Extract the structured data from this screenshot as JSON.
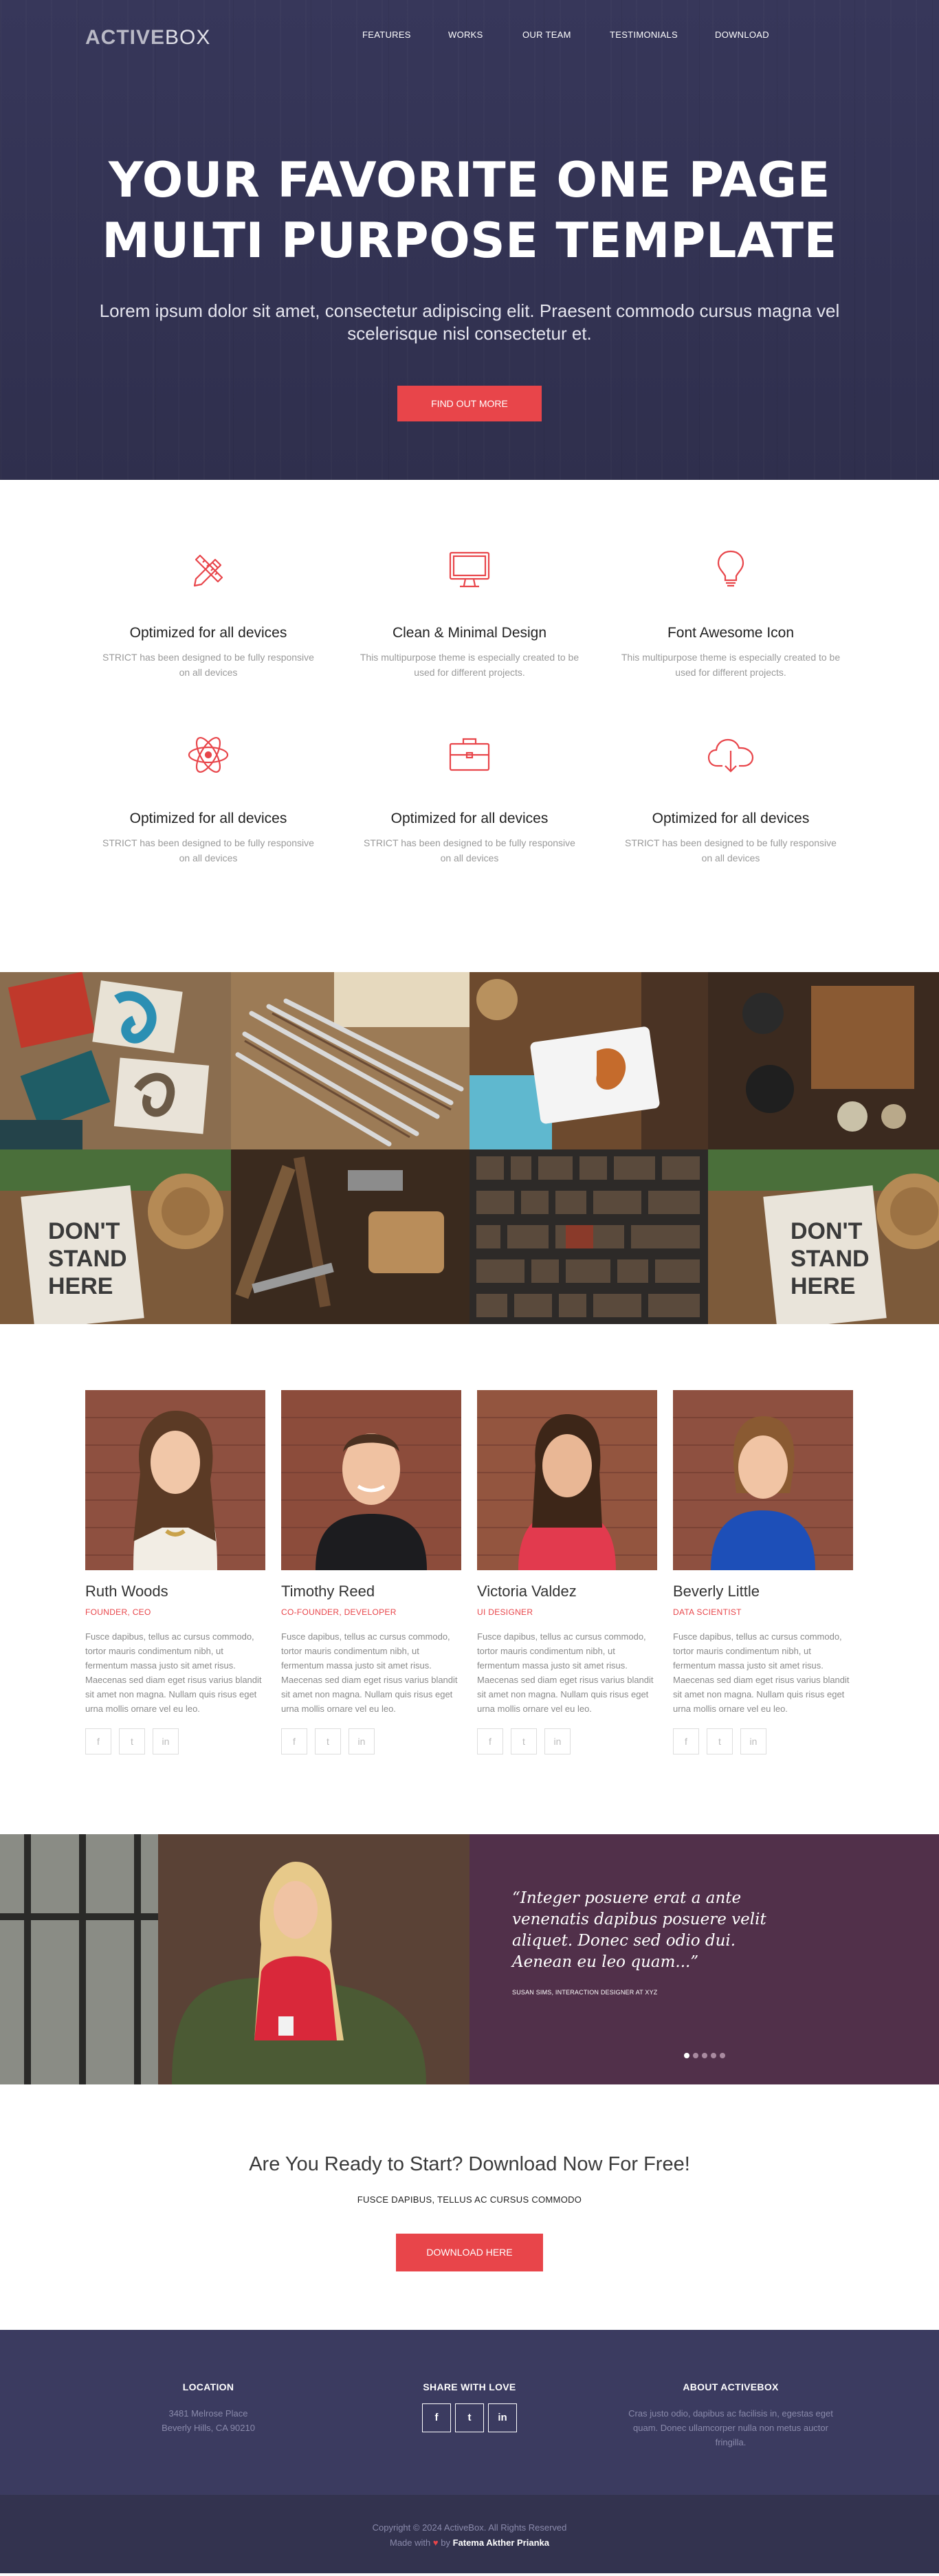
{
  "brand": {
    "logo_bold": "ACTIVE",
    "logo_light": "BOX"
  },
  "nav": [
    "FEATURES",
    "WORKS",
    "OUR TEAM",
    "TESTIMONIALS",
    "DOWNLOAD"
  ],
  "hero": {
    "title_line1": "YOUR FAVORITE ONE PAGE",
    "title_line2": "MULTI PURPOSE TEMPLATE",
    "subtitle": "Lorem ipsum dolor sit amet, consectetur adipiscing elit. Praesent commodo cursus magna vel scelerisque nisl consectetur et.",
    "button": "FIND OUT MORE"
  },
  "colors": {
    "accent": "#e8454a",
    "hero_bg": "#33334f",
    "footer_bg": "#3b3b60",
    "testimonial_bg": "#51304a"
  },
  "features": [
    {
      "icon": "pencil-ruler-icon",
      "title": "Optimized for all devices",
      "text": "STRICT has been designed to be fully responsive on all devices"
    },
    {
      "icon": "monitor-icon",
      "title": "Clean & Minimal Design",
      "text": "This multipurpose theme is especially created to be used for different projects."
    },
    {
      "icon": "lightbulb-icon",
      "title": "Font Awesome Icon",
      "text": "This multipurpose theme is especially created to be used for different projects."
    },
    {
      "icon": "atom-icon",
      "title": "Optimized for all devices",
      "text": "STRICT has been designed to be fully responsive on all devices"
    },
    {
      "icon": "briefcase-icon",
      "title": "Optimized for all devices",
      "text": "STRICT has been designed to be fully responsive on all devices"
    },
    {
      "icon": "cloud-download-icon",
      "title": "Optimized for all devices",
      "text": "STRICT has been designed to be fully responsive on all devices"
    }
  ],
  "team": [
    {
      "name": "Ruth Woods",
      "role": "FOUNDER, CEO",
      "bio": "Fusce dapibus, tellus ac cursus commodo, tortor mauris condimentum nibh, ut fermentum massa justo sit amet risus. Maecenas sed diam eget risus varius blandit sit amet non magna. Nullam quis risus eget urna mollis ornare vel eu leo."
    },
    {
      "name": "Timothy Reed",
      "role": "CO-FOUNDER, DEVELOPER",
      "bio": "Fusce dapibus, tellus ac cursus commodo, tortor mauris condimentum nibh, ut fermentum massa justo sit amet risus. Maecenas sed diam eget risus varius blandit sit amet non magna. Nullam quis risus eget urna mollis ornare vel eu leo."
    },
    {
      "name": "Victoria Valdez",
      "role": "UI DESIGNER",
      "bio": "Fusce dapibus, tellus ac cursus commodo, tortor mauris condimentum nibh, ut fermentum massa justo sit amet risus. Maecenas sed diam eget risus varius blandit sit amet non magna. Nullam quis risus eget urna mollis ornare vel eu leo."
    },
    {
      "name": "Beverly Little",
      "role": "DATA SCIENTIST",
      "bio": "Fusce dapibus, tellus ac cursus commodo, tortor mauris condimentum nibh, ut fermentum massa justo sit amet risus. Maecenas sed diam eget risus varius blandit sit amet non magna. Nullam quis risus eget urna mollis ornare vel eu leo."
    }
  ],
  "member_social_icons": [
    "facebook-icon",
    "twitter-icon",
    "linkedin-icon"
  ],
  "testimonial": {
    "quote": "“Integer posuere erat a ante venenatis dapibus posuere velit aliquet. Donec sed odio dui. Aenean eu leo quam...”",
    "author": "SUSAN SIMS, INTERACTION DESIGNER AT XYZ",
    "slides": 5,
    "active_slide": 1
  },
  "cta": {
    "title": "Are You Ready to Start? Download Now For Free!",
    "subtitle": "FUSCE DAPIBUS, TELLUS AC CURSUS COMMODO",
    "button": "DOWNLOAD HERE"
  },
  "footer": {
    "location_title": "LOCATION",
    "location_line1": "3481 Melrose Place",
    "location_line2": "Beverly Hills, CA 90210",
    "share_title": "SHARE WITH LOVE",
    "share_icons": [
      "facebook-icon",
      "twitter-icon",
      "linkedin-icon"
    ],
    "about_title": "ABOUT ACTIVEBOX",
    "about_text": "Cras justo odio, dapibus ac facilisis in, egestas eget quam. Donec ullamcorper nulla non metus auctor fringilla."
  },
  "bottom": {
    "copyright": "Copyright © 2024 ActiveBox. All Rights Reserved",
    "made_with": "Made with",
    "by": "by",
    "author": "Fatema Akther Prianka"
  }
}
